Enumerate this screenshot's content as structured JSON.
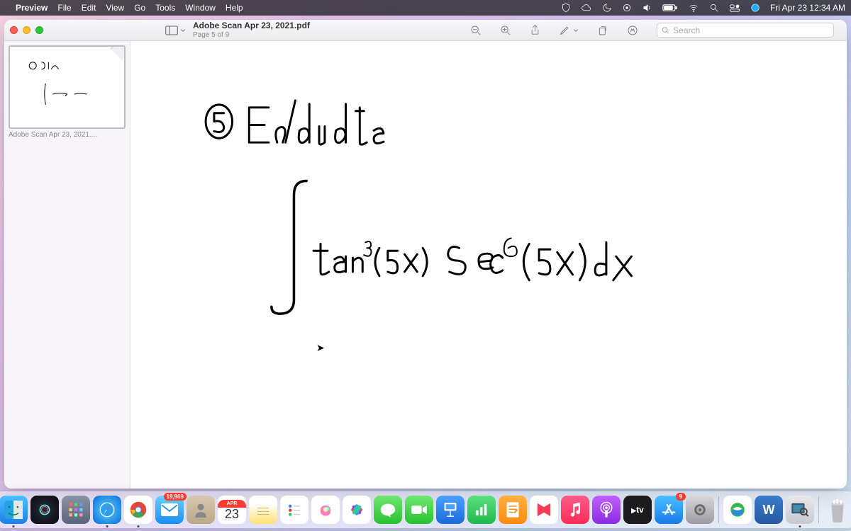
{
  "menubar": {
    "app": "Preview",
    "items": [
      "File",
      "Edit",
      "View",
      "Go",
      "Tools",
      "Window",
      "Help"
    ],
    "clock": "Fri Apr 23  12:34 AM"
  },
  "window": {
    "title": "Adobe Scan Apr 23, 2021.pdf",
    "subtitle": "Page 5 of 9",
    "search_placeholder": "Search"
  },
  "sidebar": {
    "thumb_label": "Adobe Scan Apr 23, 2021...."
  },
  "page_content": {
    "problem_number": "5",
    "heading": "Evaluate",
    "expression": "∫ tan³(5x) sec⁶(5x) dx"
  },
  "dock": {
    "mail_badge": "19,969",
    "cal_month": "APR",
    "cal_day": "23",
    "appstore_badge": "9",
    "tv_label": "tv",
    "word_label": "W"
  }
}
